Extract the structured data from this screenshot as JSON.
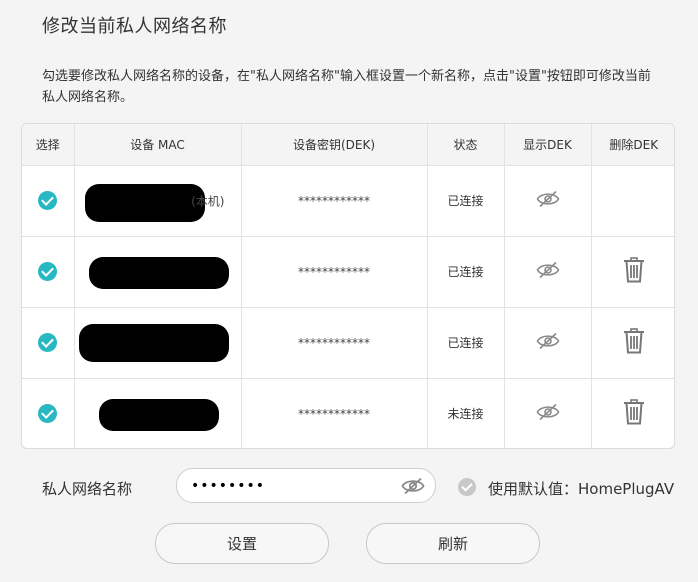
{
  "page": {
    "title": "修改当前私人网络名称",
    "description": "勾选要修改私人网络名称的设备，在\"私人网络名称\"输入框设置一个新名称，点击\"设置\"按钮即可修改当前私人网络名称。"
  },
  "table": {
    "headers": {
      "select": "选择",
      "mac": "设备 MAC",
      "dek": "设备密钥(DEK)",
      "status": "状态",
      "show_dek": "显示DEK",
      "delete_dek": "删除DEK"
    },
    "rows": [
      {
        "mac_suffix": "(本机)",
        "dek": "************",
        "status": "已连接",
        "can_delete": false
      },
      {
        "mac_suffix": "",
        "dek": "************",
        "status": "已连接",
        "can_delete": true
      },
      {
        "mac_suffix": "",
        "dek": "************",
        "status": "已连接",
        "can_delete": true
      },
      {
        "mac_suffix": "",
        "dek": "************",
        "status": "未连接",
        "can_delete": true
      }
    ]
  },
  "form": {
    "network_name_label": "私人网络名称",
    "network_name_value": "••••••••",
    "use_default_label": "使用默认值：HomePlugAV",
    "set_button": "设置",
    "refresh_button": "刷新"
  },
  "colors": {
    "accent": "#27b8c4",
    "icon_gray": "#8a8a8a"
  }
}
